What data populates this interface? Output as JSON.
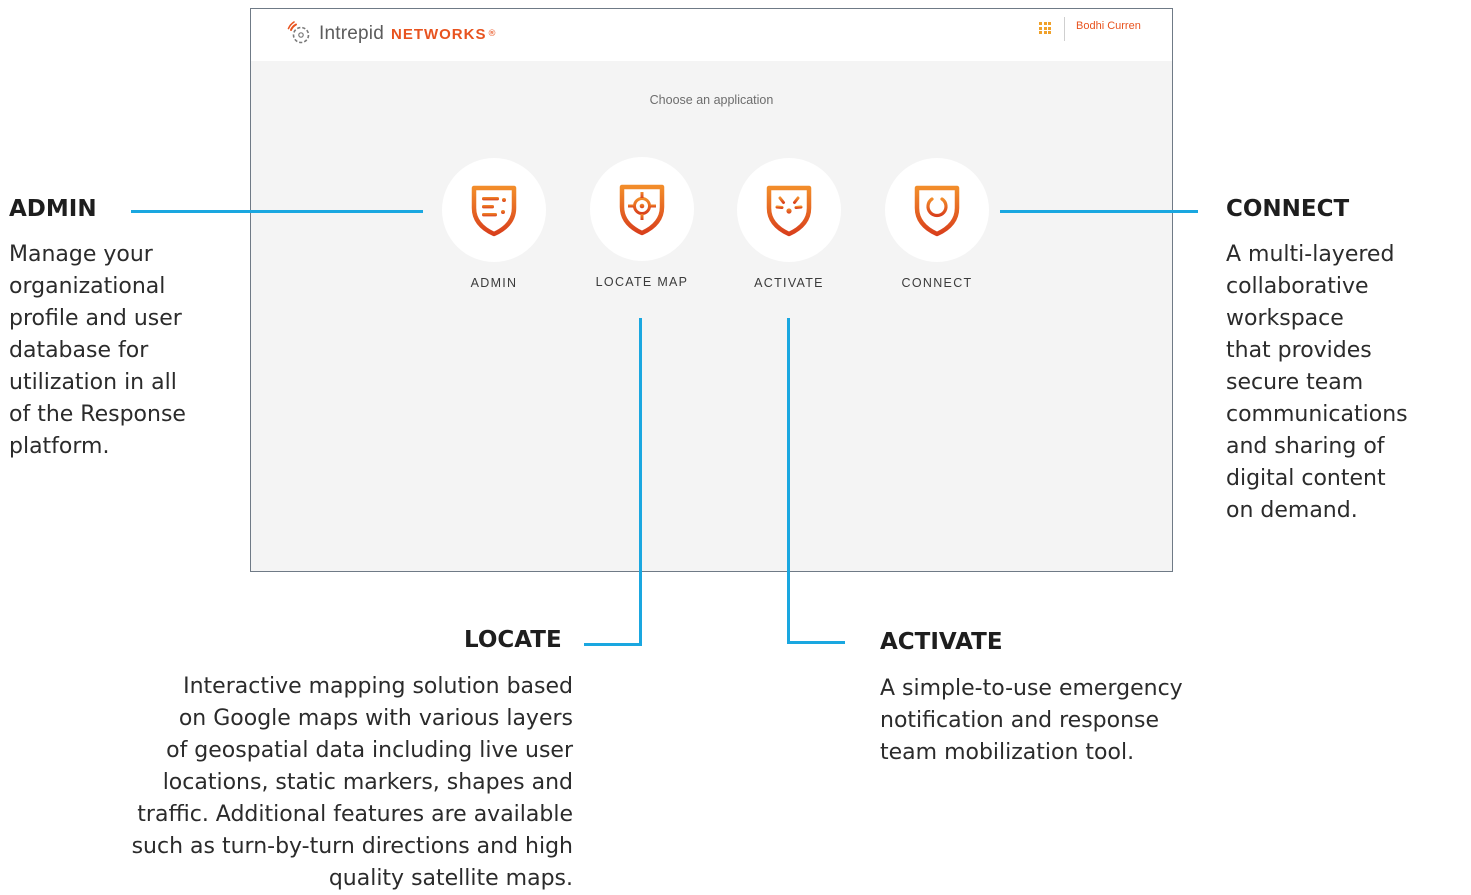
{
  "app": {
    "brand_word": "Intrepid",
    "brand_name": "NETWORKS",
    "brand_mark": "®",
    "user_name": "Bodhi Curren",
    "choose_title": "Choose an application",
    "apps": [
      {
        "label": "ADMIN",
        "icon": "admin-shield-icon"
      },
      {
        "label": "LOCATE MAP",
        "icon": "locate-target-shield-icon"
      },
      {
        "label": "ACTIVATE",
        "icon": "activate-burst-shield-icon"
      },
      {
        "label": "CONNECT",
        "icon": "connect-power-shield-icon"
      }
    ]
  },
  "callouts": {
    "admin": {
      "title": "ADMIN",
      "lines": [
        "Manage your",
        "organizational",
        "profile and user",
        "database for",
        "utilization in all",
        "of the Response",
        "platform."
      ]
    },
    "connect": {
      "title": "CONNECT",
      "lines": [
        "A multi-layered",
        "collaborative",
        "workspace",
        "that provides",
        "secure team",
        "communications",
        "and sharing of",
        "digital content",
        "on demand."
      ]
    },
    "locate": {
      "title": "LOCATE",
      "lines": [
        "Interactive mapping solution based",
        "on Google maps with various layers",
        "of geospatial data including live user",
        "locations, static markers, shapes and",
        "traffic. Additional features are available",
        "such as turn-by-turn directions and high",
        "quality satellite maps."
      ]
    },
    "activate": {
      "title": "ACTIVATE",
      "lines": [
        "A simple-to-use emergency",
        "notification and response",
        "team mobilization tool."
      ]
    }
  },
  "colors": {
    "accent_orange": "#e8531f",
    "icon_gradient_top": "#f28c2a",
    "icon_gradient_bottom": "#d9401c",
    "callout_line": "#1aa7e0",
    "app_background": "#f4f4f4"
  }
}
